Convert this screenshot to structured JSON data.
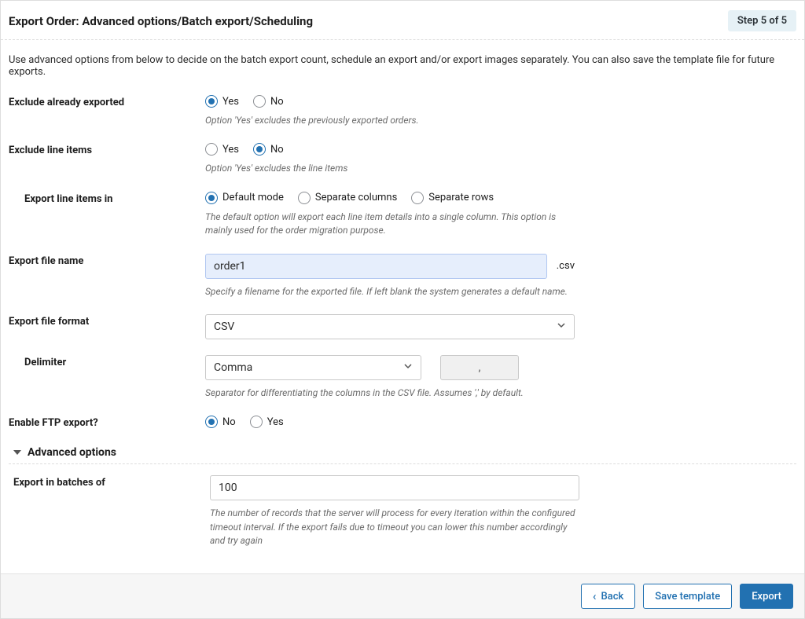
{
  "header": {
    "title": "Export Order: Advanced options/Batch export/Scheduling",
    "step": "Step 5 of 5"
  },
  "intro": "Use advanced options from below to decide on the batch export count, schedule an export and/or export images separately. You can also save the template file for future exports.",
  "fields": {
    "exclude_exported": {
      "label": "Exclude already exported",
      "yes": "Yes",
      "no": "No",
      "hint": "Option 'Yes' excludes the previously exported orders."
    },
    "exclude_line_items": {
      "label": "Exclude line items",
      "yes": "Yes",
      "no": "No",
      "hint": "Option 'Yes' excludes the line items"
    },
    "export_line_mode": {
      "label": "Export line items in",
      "opt_default": "Default mode",
      "opt_cols": "Separate columns",
      "opt_rows": "Separate rows",
      "hint": "The default option will export each line item details into a single column. This option is mainly used for the order migration purpose."
    },
    "file_name": {
      "label": "Export file name",
      "value": "order1",
      "ext": ".csv",
      "hint": "Specify a filename for the exported file. If left blank the system generates a default name."
    },
    "file_format": {
      "label": "Export file format",
      "value": "CSV"
    },
    "delimiter": {
      "label": "Delimiter",
      "value": "Comma",
      "char": ",",
      "hint": "Separator for differentiating the columns in the CSV file. Assumes ',' by default."
    },
    "ftp": {
      "label": "Enable FTP export?",
      "no": "No",
      "yes": "Yes"
    }
  },
  "advanced": {
    "header": "Advanced options",
    "batch": {
      "label": "Export in batches of",
      "value": "100",
      "hint": "The number of records that the server will process for every iteration within the configured timeout interval. If the export fails due to timeout you can lower this number accordingly and try again"
    }
  },
  "footer": {
    "back": "Back",
    "save": "Save template",
    "export": "Export"
  }
}
